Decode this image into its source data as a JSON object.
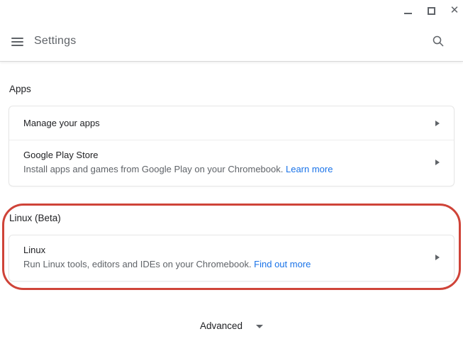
{
  "window": {
    "controls": {
      "minimize": "minimize",
      "maximize": "maximize",
      "close_glyph": "✕"
    }
  },
  "header": {
    "title": "Settings",
    "menu_icon": "hamburger-menu",
    "search_icon": "magnifier"
  },
  "sections": [
    {
      "heading": "Apps",
      "rows": [
        {
          "title": "Manage your apps"
        },
        {
          "title": "Google Play Store",
          "subtitle": "Install apps and games from Google Play on your Chromebook. ",
          "link": "Learn more"
        }
      ]
    },
    {
      "heading": "Linux (Beta)",
      "rows": [
        {
          "title": "Linux",
          "subtitle": "Run Linux tools, editors and IDEs on your Chromebook. ",
          "link": "Find out more"
        }
      ]
    }
  ],
  "footer": {
    "advanced_label": "Advanced"
  },
  "colors": {
    "link_blue": "#1a73e8",
    "annotation_red": "#cf4338",
    "primary_text": "#202124",
    "secondary_text": "#5f6368"
  }
}
